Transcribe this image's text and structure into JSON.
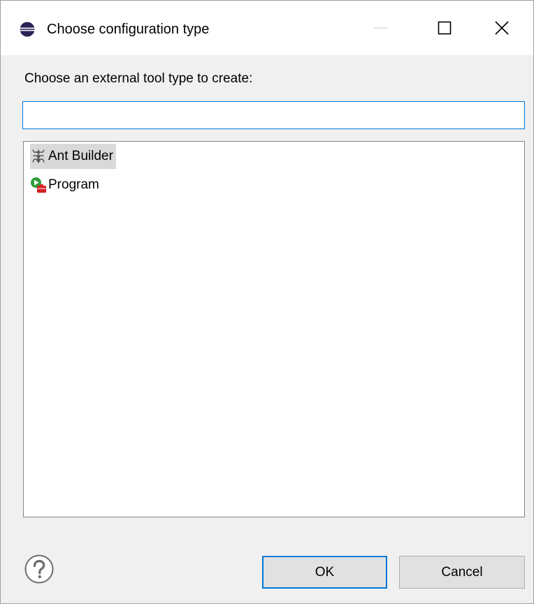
{
  "window": {
    "title": "Choose configuration type",
    "icon": "eclipse-icon"
  },
  "titlebar_controls": {
    "minimize": "minimize-icon",
    "maximize": "maximize-icon",
    "close": "close-icon"
  },
  "dialog": {
    "prompt": "Choose an external tool type to create:",
    "filter": {
      "value": "",
      "placeholder": ""
    },
    "items": [
      {
        "label": "Ant Builder",
        "icon": "ant-icon",
        "selected": true
      },
      {
        "label": "Program",
        "icon": "program-launch-icon",
        "selected": false
      }
    ]
  },
  "footer": {
    "help_icon": "help-icon",
    "ok_label": "OK",
    "cancel_label": "Cancel"
  },
  "colors": {
    "focus_blue": "#0078d7",
    "selection_gray": "#d9d9d9",
    "dialog_bg": "#f0f0f0",
    "button_bg": "#e1e1e1",
    "program_green": "#2e9e3a",
    "program_red": "#d42020"
  }
}
